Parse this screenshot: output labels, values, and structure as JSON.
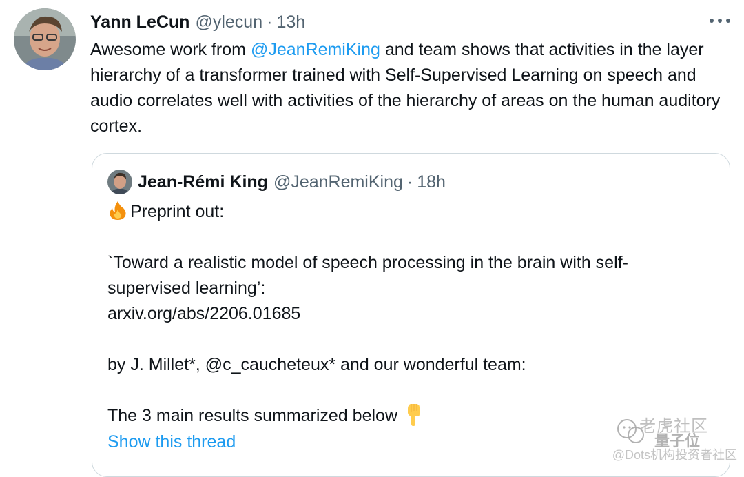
{
  "main_tweet": {
    "author_name": "Yann LeCun",
    "author_handle": "@ylecun",
    "separator": "·",
    "time": "13h",
    "text_before_mention": "Awesome work from ",
    "mention": "@JeanRemiKing",
    "text_after_mention": " and team shows that activities in the layer hierarchy of a transformer trained with Self-Supervised Learning on speech and audio correlates well with activities of the hierarchy of areas on the human auditory cortex.",
    "more_icon": "more-horizontal-icon"
  },
  "quoted_tweet": {
    "author_name": "Jean-Rémi King",
    "author_handle": "@JeanRemiKing",
    "separator": "·",
    "time": "18h",
    "line1": "Preprint out:",
    "line2": "`Toward a realistic model of speech processing in the brain with self-",
    "line3": "supervised learning’:",
    "line4": "arxiv.org/abs/2206.01685",
    "line5": "by J. Millet*, @c_caucheteux* and our wonderful team:",
    "line6": "The 3 main results summarized below",
    "show_thread": "Show this thread",
    "fire_icon": "fire-emoji-icon",
    "point_icon": "pointing-down-emoji-icon"
  },
  "watermark": {
    "line1": "老虎社区",
    "line2": "量子位",
    "bottom": "@Dots机构投资者社区"
  },
  "colors": {
    "link": "#1d9bf0",
    "secondary_text": "#536471",
    "border": "#cfd9de",
    "primary_text": "#0f1419"
  }
}
